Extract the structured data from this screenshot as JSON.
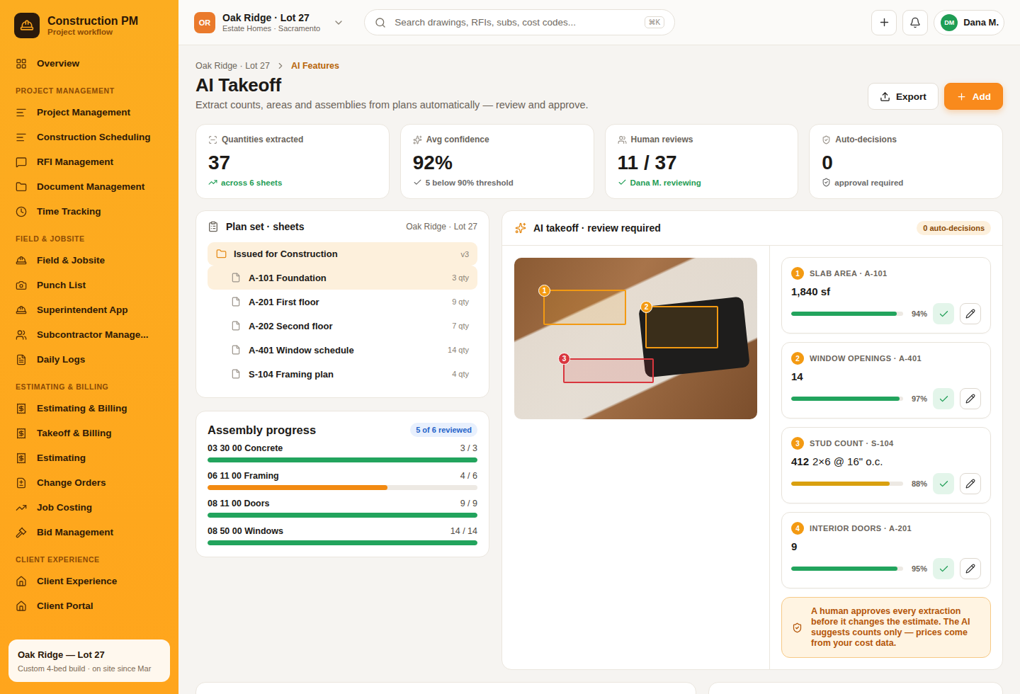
{
  "brand": {
    "title": "Construction PM",
    "subtitle": "Project workflow"
  },
  "sidebar": {
    "sections": [
      {
        "label": "",
        "items": [
          {
            "label": "Overview",
            "selected": false
          }
        ]
      },
      {
        "label": "PROJECT MANAGEMENT",
        "items": [
          {
            "label": "Project Management",
            "selected": false
          },
          {
            "label": "Construction Scheduling",
            "selected": false
          },
          {
            "label": "RFI Management",
            "selected": false
          },
          {
            "label": "Document Management",
            "selected": false
          },
          {
            "label": "Time Tracking",
            "selected": false
          }
        ]
      },
      {
        "label": "FIELD & JOBSITE",
        "items": [
          {
            "label": "Field & Jobsite",
            "selected": false
          },
          {
            "label": "Punch List",
            "selected": false
          },
          {
            "label": "Superintendent App",
            "selected": false
          },
          {
            "label": "Subcontractor Manage...",
            "selected": false
          },
          {
            "label": "Daily Logs",
            "selected": false
          }
        ]
      },
      {
        "label": "ESTIMATING & BILLING",
        "items": [
          {
            "label": "Estimating & Billing",
            "selected": false
          },
          {
            "label": "Takeoff & Billing",
            "selected": false
          },
          {
            "label": "Estimating",
            "selected": false
          },
          {
            "label": "Change Orders",
            "selected": false
          },
          {
            "label": "Job Costing",
            "selected": false
          },
          {
            "label": "Bid Management",
            "selected": false
          }
        ]
      },
      {
        "label": "CLIENT EXPERIENCE",
        "items": [
          {
            "label": "Client Experience",
            "selected": false
          },
          {
            "label": "Client Portal",
            "selected": false
          }
        ]
      }
    ],
    "footer": {
      "title": "Oak Ridge — Lot 27",
      "subtitle": "Custom 4-bed build · on site since Mar"
    }
  },
  "topbar": {
    "project": {
      "initials": "OR",
      "name": "Oak Ridge · Lot 27",
      "sub": "Estate Homes · Sacramento"
    },
    "search": {
      "placeholder": "Search drawings, RFIs, subs, cost codes...",
      "shortcut": "⌘K"
    },
    "user": {
      "initials": "DM",
      "name": "Dana M."
    }
  },
  "breadcrumb": [
    {
      "label": "Oak Ridge · Lot 27",
      "selected": false
    },
    {
      "label": "AI Features",
      "selected": true
    }
  ],
  "page": {
    "title": "AI Takeoff",
    "subtitle": "Extract counts, areas and assemblies from plans automatically — review and approve.",
    "buttons": [
      {
        "label": "Export",
        "kind": "secondary"
      },
      {
        "label": "Add",
        "kind": "primary"
      }
    ]
  },
  "stats": [
    {
      "label": "Quantities extracted",
      "value": "37",
      "note": "across 6 sheets",
      "color": "#1f9d55"
    },
    {
      "label": "Avg confidence",
      "value": "92%",
      "note": "5 below 90% threshold",
      "color": "#6b6b6b"
    },
    {
      "label": "Human reviews",
      "value": "11 / 37",
      "note": "Dana M. reviewing",
      "color": "#1f9d55"
    },
    {
      "label": "Auto-decisions",
      "value": "0",
      "note": "approval required",
      "color": "#6b6b6b"
    }
  ],
  "plan_set": {
    "title": "Plan set · sheets",
    "meta": "Oak Ridge · Lot 27",
    "folder": {
      "label": "Issued for Construction",
      "version": "v3"
    },
    "sheets": [
      {
        "label": "A-101 Foundation",
        "qty": "3 qty",
        "selected": true
      },
      {
        "label": "A-201 First floor",
        "qty": "9 qty",
        "selected": false
      },
      {
        "label": "A-202 Second floor",
        "qty": "7 qty",
        "selected": false
      },
      {
        "label": "A-401 Window schedule",
        "qty": "14 qty",
        "selected": false
      },
      {
        "label": "S-104 Framing plan",
        "qty": "4 qty",
        "selected": false
      }
    ]
  },
  "assembly": {
    "title": "Assembly progress",
    "badge": "5 of 6 reviewed",
    "rows": [
      {
        "name": "03 30 00 Concrete",
        "count": "3 / 3",
        "level": 1,
        "color": "#22a45d"
      },
      {
        "name": "06 11 00 Framing",
        "count": "4 / 6",
        "level": 0.667,
        "color": "#f28a12"
      },
      {
        "name": "08 11 00 Doors",
        "count": "9 / 9",
        "level": 1,
        "color": "#22a45d"
      },
      {
        "name": "08 50 00 Windows",
        "count": "14 / 14",
        "level": 1,
        "color": "#22a45d"
      }
    ]
  },
  "review": {
    "title": "AI takeoff · review required",
    "badge": "0 auto-decisions",
    "markers": [
      {
        "label": "1",
        "color": "#f39a12"
      },
      {
        "label": "2",
        "color": "#f39a12"
      },
      {
        "label": "3",
        "color": "#d9363e"
      }
    ],
    "items": [
      {
        "number": "1",
        "label": "SLAB AREA · A-101",
        "value": "1,840 sf",
        "unit": "",
        "level": 0.94,
        "reading": "94%",
        "color": "#22a45d"
      },
      {
        "number": "2",
        "label": "WINDOW OPENINGS · A-401",
        "value": "14",
        "unit": "",
        "level": 0.97,
        "reading": "97%",
        "color": "#22a45d"
      },
      {
        "number": "3",
        "label": "STUD COUNT · S-104",
        "value": "412",
        "unit": "2×6 @ 16\" o.c.",
        "level": 0.88,
        "reading": "88%",
        "color": "#d9a00f"
      },
      {
        "number": "4",
        "label": "INTERIOR DOORS · A-201",
        "value": "9",
        "unit": "",
        "level": 0.95,
        "reading": "95%",
        "color": "#22a45d"
      }
    ],
    "note": "A human approves every extraction before it changes the estimate. The AI suggests counts only — prices come from your cost data."
  }
}
